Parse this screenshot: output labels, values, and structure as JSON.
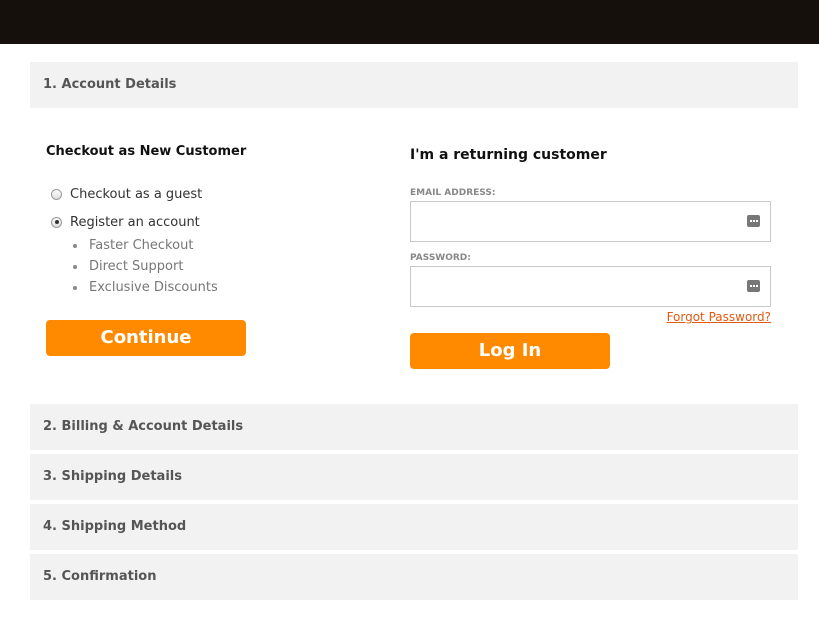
{
  "sections": {
    "account_details": "1. Account Details",
    "billing": "2. Billing & Account Details",
    "shipping_details": "3. Shipping Details",
    "shipping_method": "4. Shipping Method",
    "confirmation": "5. Confirmation"
  },
  "new_customer": {
    "title": "Checkout as New Customer",
    "options": [
      {
        "label": "Checkout as a guest",
        "selected": false
      },
      {
        "label": "Register an account",
        "selected": true
      }
    ],
    "benefits": [
      "Faster Checkout",
      "Direct Support",
      "Exclusive Discounts"
    ],
    "continue_label": "Continue"
  },
  "returning_customer": {
    "title": "I'm a returning customer",
    "email_label": "EMAIL ADDRESS:",
    "email_value": "",
    "password_label": "PASSWORD:",
    "password_value": "",
    "forgot_label": "Forgot Password?",
    "login_label": "Log In"
  },
  "colors": {
    "accent": "#ff8a00",
    "link": "#e05a12",
    "topbar": "#15100c",
    "section_bg": "#f2f2f2"
  },
  "icons": {
    "field_icon": "password-manager-key-icon"
  }
}
